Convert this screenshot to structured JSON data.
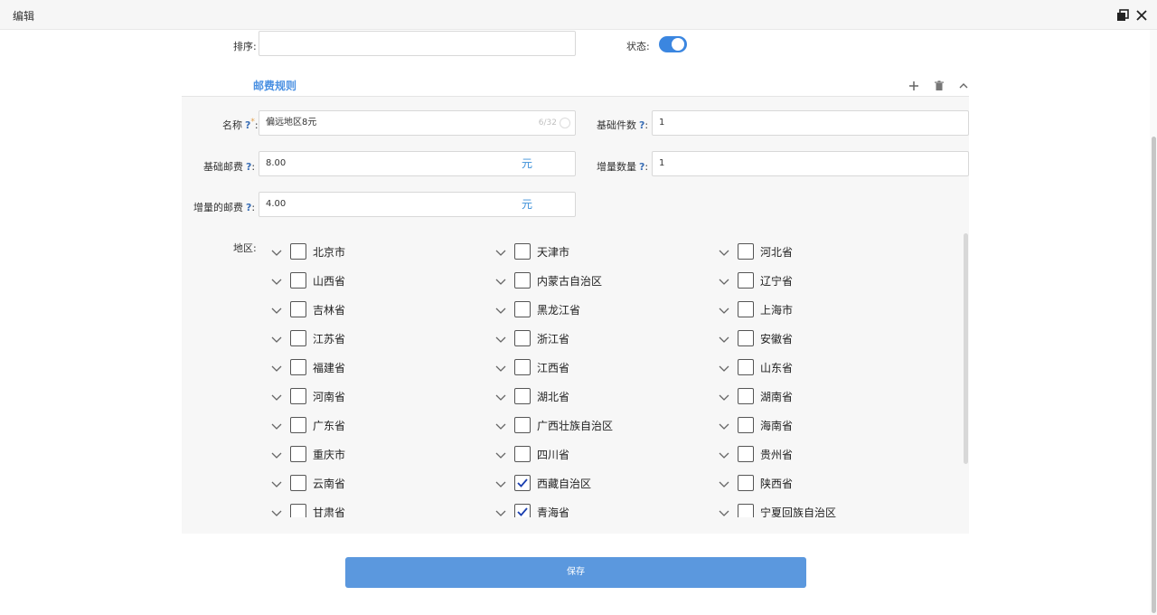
{
  "window": {
    "title": "编辑"
  },
  "form": {
    "sort_label": "排序:",
    "sort_value": "",
    "status_label": "状态:",
    "status_on": true
  },
  "section": {
    "title": "邮费规则",
    "name_label": "名称",
    "name_value": "偏远地区8元",
    "name_count": "6/32",
    "base_count_label": "基础件数",
    "base_count_value": "1",
    "base_fee_label": "基础邮费",
    "base_fee_value": "8.00",
    "base_fee_suffix": "元",
    "inc_count_label": "增量数量",
    "inc_count_value": "1",
    "inc_fee_label": "增量的邮费",
    "inc_fee_value": "4.00",
    "inc_fee_suffix": "元",
    "help_mark": "?",
    "colon": ":",
    "required_mark": "*",
    "region_label": "地区:"
  },
  "regions": [
    {
      "name": "北京市",
      "checked": false
    },
    {
      "name": "天津市",
      "checked": false
    },
    {
      "name": "河北省",
      "checked": false
    },
    {
      "name": "山西省",
      "checked": false
    },
    {
      "name": "内蒙古自治区",
      "checked": false
    },
    {
      "name": "辽宁省",
      "checked": false
    },
    {
      "name": "吉林省",
      "checked": false
    },
    {
      "name": "黑龙江省",
      "checked": false
    },
    {
      "name": "上海市",
      "checked": false
    },
    {
      "name": "江苏省",
      "checked": false
    },
    {
      "name": "浙江省",
      "checked": false
    },
    {
      "name": "安徽省",
      "checked": false
    },
    {
      "name": "福建省",
      "checked": false
    },
    {
      "name": "江西省",
      "checked": false
    },
    {
      "name": "山东省",
      "checked": false
    },
    {
      "name": "河南省",
      "checked": false
    },
    {
      "name": "湖北省",
      "checked": false
    },
    {
      "name": "湖南省",
      "checked": false
    },
    {
      "name": "广东省",
      "checked": false
    },
    {
      "name": "广西壮族自治区",
      "checked": false
    },
    {
      "name": "海南省",
      "checked": false
    },
    {
      "name": "重庆市",
      "checked": false
    },
    {
      "name": "四川省",
      "checked": false
    },
    {
      "name": "贵州省",
      "checked": false
    },
    {
      "name": "云南省",
      "checked": false
    },
    {
      "name": "西藏自治区",
      "checked": true
    },
    {
      "name": "陕西省",
      "checked": false
    },
    {
      "name": "甘肃省",
      "checked": false
    },
    {
      "name": "青海省",
      "checked": true
    },
    {
      "name": "宁夏回族自治区",
      "checked": false
    }
  ],
  "actions": {
    "save_label": "保存"
  },
  "colors": {
    "accent": "#4a90e2",
    "button": "#5b98de",
    "toggle": "#3b86e0"
  },
  "icons": {
    "restore": "restore-icon",
    "close": "close-icon",
    "add": "plus-icon",
    "delete": "trash-icon",
    "collapse": "chevron-up-icon",
    "expand": "chevron-down-icon",
    "check": "checkmark-icon"
  }
}
